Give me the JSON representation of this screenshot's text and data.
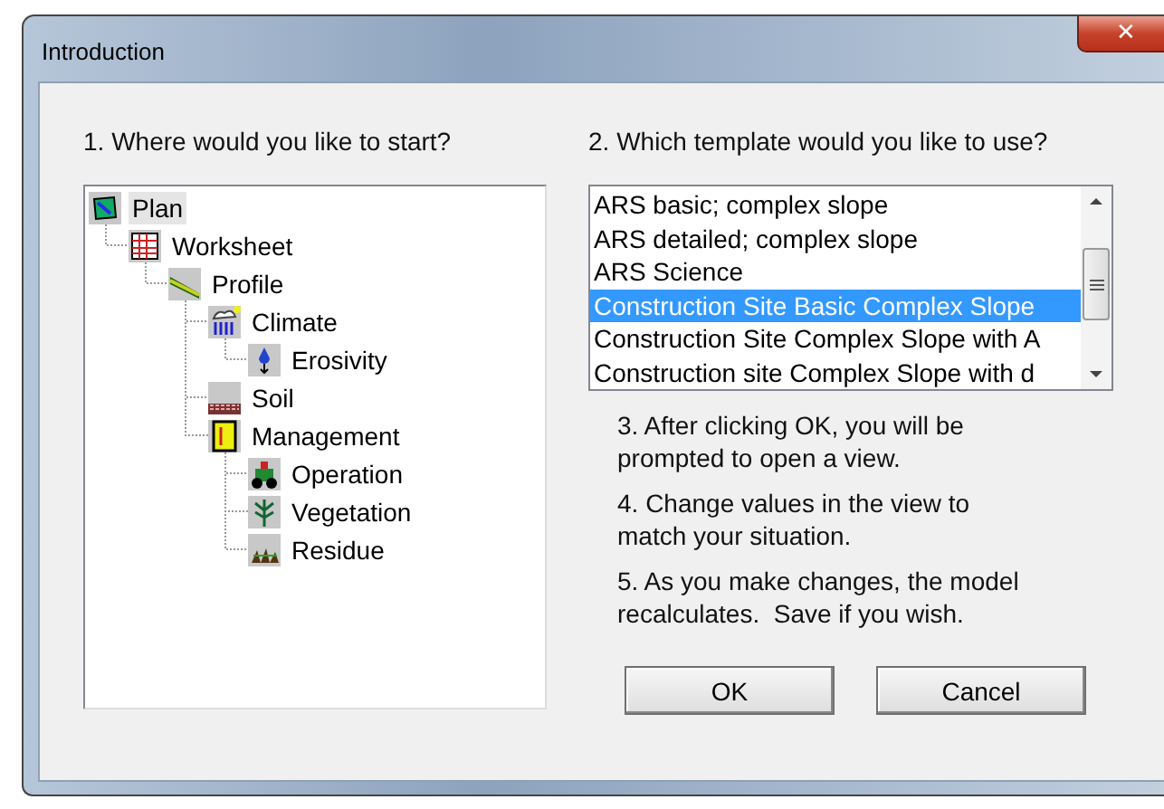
{
  "window": {
    "title": "Introduction",
    "close": "✕"
  },
  "left_prompt": "1. Where would you like to start?",
  "tree": [
    {
      "label": "Plan",
      "kind": "plan",
      "selected": true,
      "children": [
        {
          "label": "Worksheet",
          "kind": "worksheet",
          "selected": false,
          "children": [
            {
              "label": "Profile",
              "kind": "profile",
              "selected": false,
              "children": [
                {
                  "label": "Climate",
                  "kind": "climate",
                  "selected": false,
                  "children": [
                    {
                      "label": "Erosivity",
                      "kind": "erosivity",
                      "selected": false
                    }
                  ]
                },
                {
                  "label": "Soil",
                  "kind": "soil",
                  "selected": false
                },
                {
                  "label": "Management",
                  "kind": "management",
                  "selected": false,
                  "children": [
                    {
                      "label": "Operation",
                      "kind": "operation",
                      "selected": false
                    },
                    {
                      "label": "Vegetation",
                      "kind": "vegetation",
                      "selected": false
                    },
                    {
                      "label": "Residue",
                      "kind": "residue",
                      "selected": false
                    }
                  ]
                }
              ]
            }
          ]
        }
      ]
    }
  ],
  "right_prompt": "2. Which template would you like to use?",
  "templates": [
    {
      "label": "ARS basic; complex slope",
      "selected": false
    },
    {
      "label": "ARS detailed; complex slope",
      "selected": false
    },
    {
      "label": "ARS Science",
      "selected": false
    },
    {
      "label": "Construction Site Basic Complex Slope",
      "selected": true
    },
    {
      "label": "Construction Site Complex Slope with A",
      "selected": false
    },
    {
      "label": "Construction site Complex Slope with d",
      "selected": false
    }
  ],
  "steps": [
    "3. After clicking OK, you will be prompted to open a view.",
    "4. Change values in the view to match your situation.",
    "5. As you make changes, the model recalculates.  Save if you wish."
  ],
  "buttons": [
    "OK",
    "Cancel"
  ]
}
